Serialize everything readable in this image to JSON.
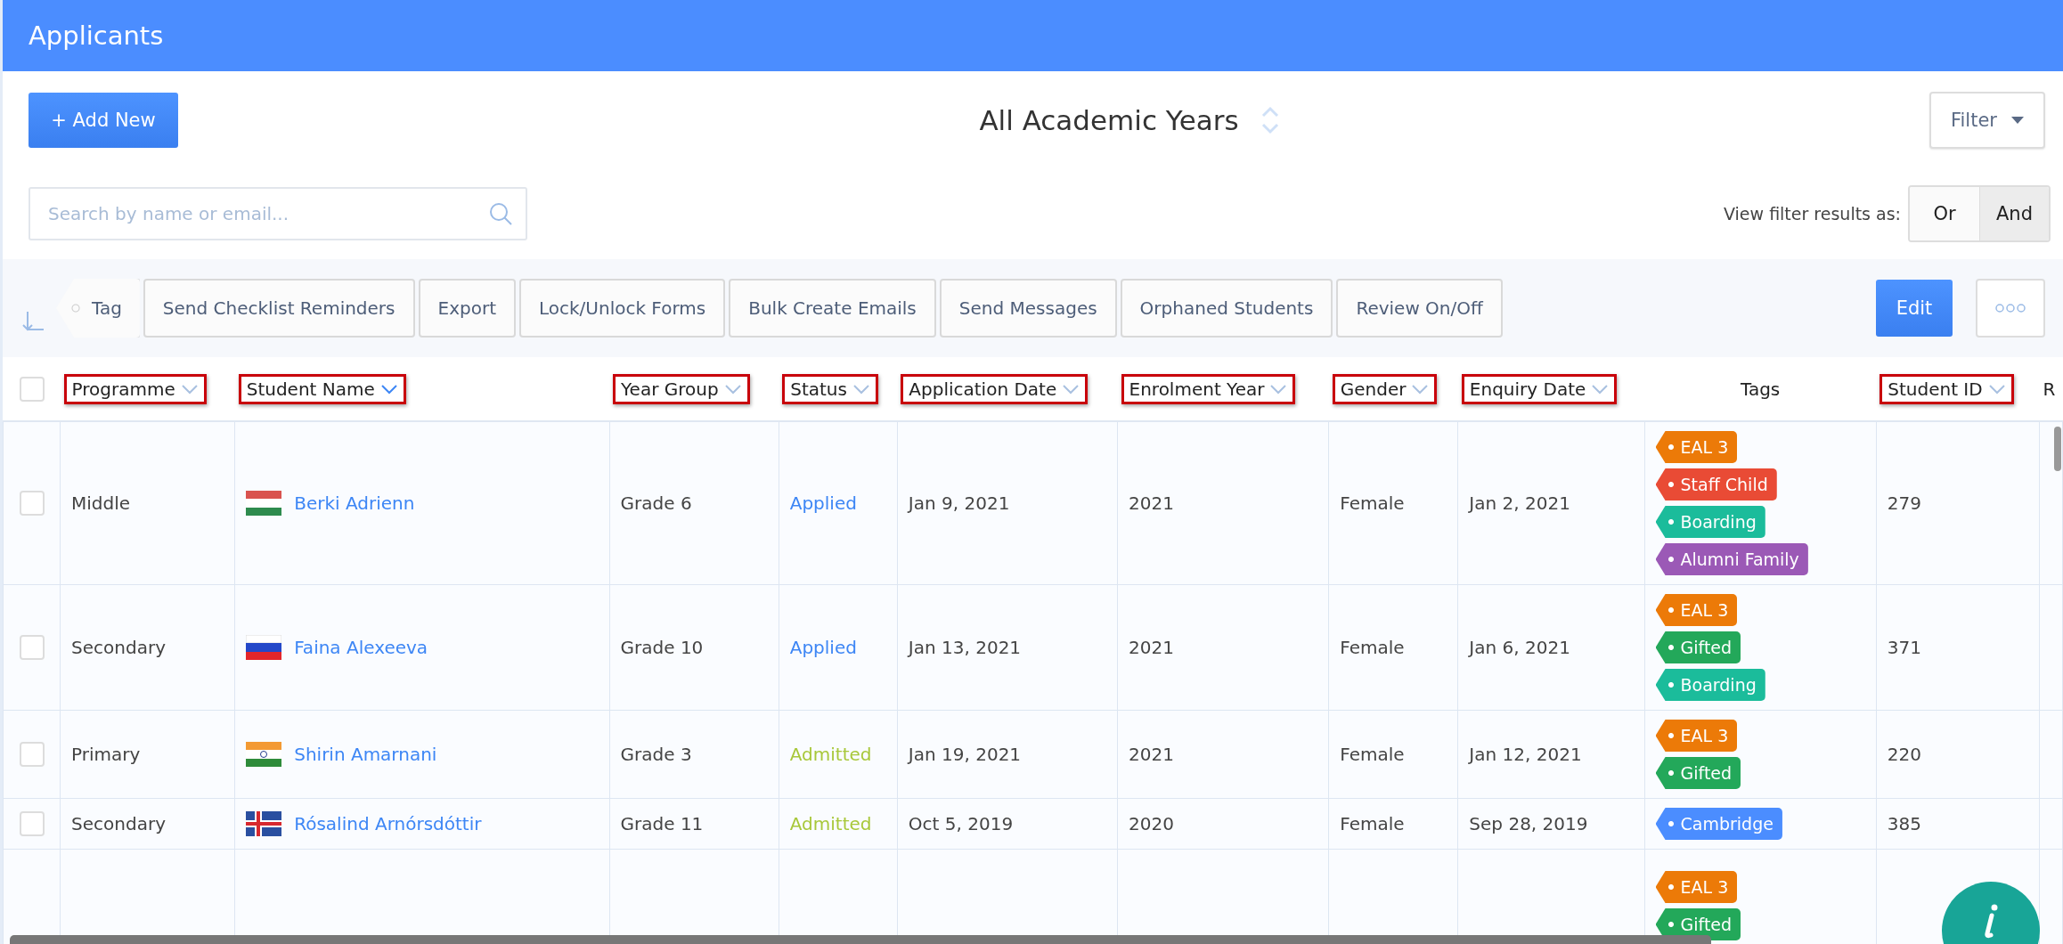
{
  "page": {
    "title": "Applicants"
  },
  "top_bar": {
    "add_button": "+ Add New",
    "year_selector": "All Academic Years",
    "filter_button": "Filter"
  },
  "search": {
    "placeholder": "Search by name or email..."
  },
  "filter_mode": {
    "label": "View filter results as:",
    "options": [
      {
        "label": "Or",
        "selected": false
      },
      {
        "label": "And",
        "selected": true
      }
    ]
  },
  "actions": [
    {
      "label": "Tag",
      "kind": "tag"
    },
    {
      "label": "Send Checklist Reminders",
      "kind": "plain"
    },
    {
      "label": "Export",
      "kind": "plain"
    },
    {
      "label": "Lock/Unlock Forms",
      "kind": "plain"
    },
    {
      "label": "Bulk Create Emails",
      "kind": "plain"
    },
    {
      "label": "Send Messages",
      "kind": "plain"
    },
    {
      "label": "Orphaned Students",
      "kind": "plain"
    },
    {
      "label": "Review On/Off",
      "kind": "plain"
    }
  ],
  "edit_button": "Edit",
  "table": {
    "select_all": {
      "checked": false
    },
    "columns": [
      {
        "label": "Programme",
        "sortable": true,
        "highlighted": true
      },
      {
        "label": "Student Name",
        "sortable": true,
        "highlighted": true
      },
      {
        "label": "Year Group",
        "sortable": true,
        "highlighted": true
      },
      {
        "label": "Status",
        "sortable": true,
        "highlighted": true
      },
      {
        "label": "Application Date",
        "sortable": true,
        "highlighted": true
      },
      {
        "label": "Enrolment Year",
        "sortable": true,
        "highlighted": true
      },
      {
        "label": "Gender",
        "sortable": true,
        "highlighted": true
      },
      {
        "label": "Enquiry Date",
        "sortable": true,
        "highlighted": true
      },
      {
        "label": "Tags",
        "sortable": false,
        "highlighted": false
      },
      {
        "label": "Student ID",
        "sortable": true,
        "highlighted": true
      },
      {
        "label": "R",
        "sortable": false,
        "highlighted": false
      }
    ],
    "rows": [
      {
        "checked": false,
        "programme": "Middle",
        "kind": "hu",
        "student_name": "Berki Adrienn",
        "year_group": "Grade 6",
        "status": {
          "text": "Applied",
          "color": "#3d86f5"
        },
        "application_date": "Jan 9, 2021",
        "enrolment_year": "2021",
        "gender": "Female",
        "enquiry_date": "Jan 2, 2021",
        "tags": [
          {
            "label": "EAL 3",
            "color": "#ec7a08"
          },
          {
            "label": "Staff Child",
            "color": "#e94b35"
          },
          {
            "label": "Boarding",
            "color": "#1bbc9b"
          },
          {
            "label": "Alumni Family",
            "color": "#9b59b6"
          }
        ],
        "student_id": "279"
      },
      {
        "checked": false,
        "programme": "Secondary",
        "kind": "ru",
        "student_name": "Faina Alexeeva",
        "year_group": "Grade 10",
        "status": {
          "text": "Applied",
          "color": "#3d86f5"
        },
        "application_date": "Jan 13, 2021",
        "enrolment_year": "2021",
        "gender": "Female",
        "enquiry_date": "Jan 6, 2021",
        "tags": [
          {
            "label": "EAL 3",
            "color": "#ec7a08"
          },
          {
            "label": "Gifted",
            "color": "#23a85a"
          },
          {
            "label": "Boarding",
            "color": "#1bbc9b"
          }
        ],
        "student_id": "371"
      },
      {
        "checked": false,
        "programme": "Primary",
        "kind": "in",
        "student_name": "Shirin Amarnani",
        "year_group": "Grade 3",
        "status": {
          "text": "Admitted",
          "color": "#a8c83a"
        },
        "application_date": "Jan 19, 2021",
        "enrolment_year": "2021",
        "gender": "Female",
        "enquiry_date": "Jan 12, 2021",
        "tags": [
          {
            "label": "EAL 3",
            "color": "#ec7a08"
          },
          {
            "label": "Gifted",
            "color": "#23a85a"
          }
        ],
        "student_id": "220"
      },
      {
        "checked": false,
        "programme": "Secondary",
        "kind": "is",
        "student_name": "Rósalind Arnórsdóttir",
        "year_group": "Grade 11",
        "status": {
          "text": "Admitted",
          "color": "#a8c83a"
        },
        "application_date": "Oct 5, 2019",
        "enrolment_year": "2020",
        "gender": "Female",
        "enquiry_date": "Sep 28, 2019",
        "tags": [
          {
            "label": "Cambridge",
            "color": "#4b8dff"
          }
        ],
        "student_id": "385"
      },
      {
        "tags": [
          {
            "label": "EAL 3",
            "color": "#ec7a08"
          },
          {
            "label": "Gifted",
            "color": "#23a85a"
          }
        ]
      }
    ]
  }
}
